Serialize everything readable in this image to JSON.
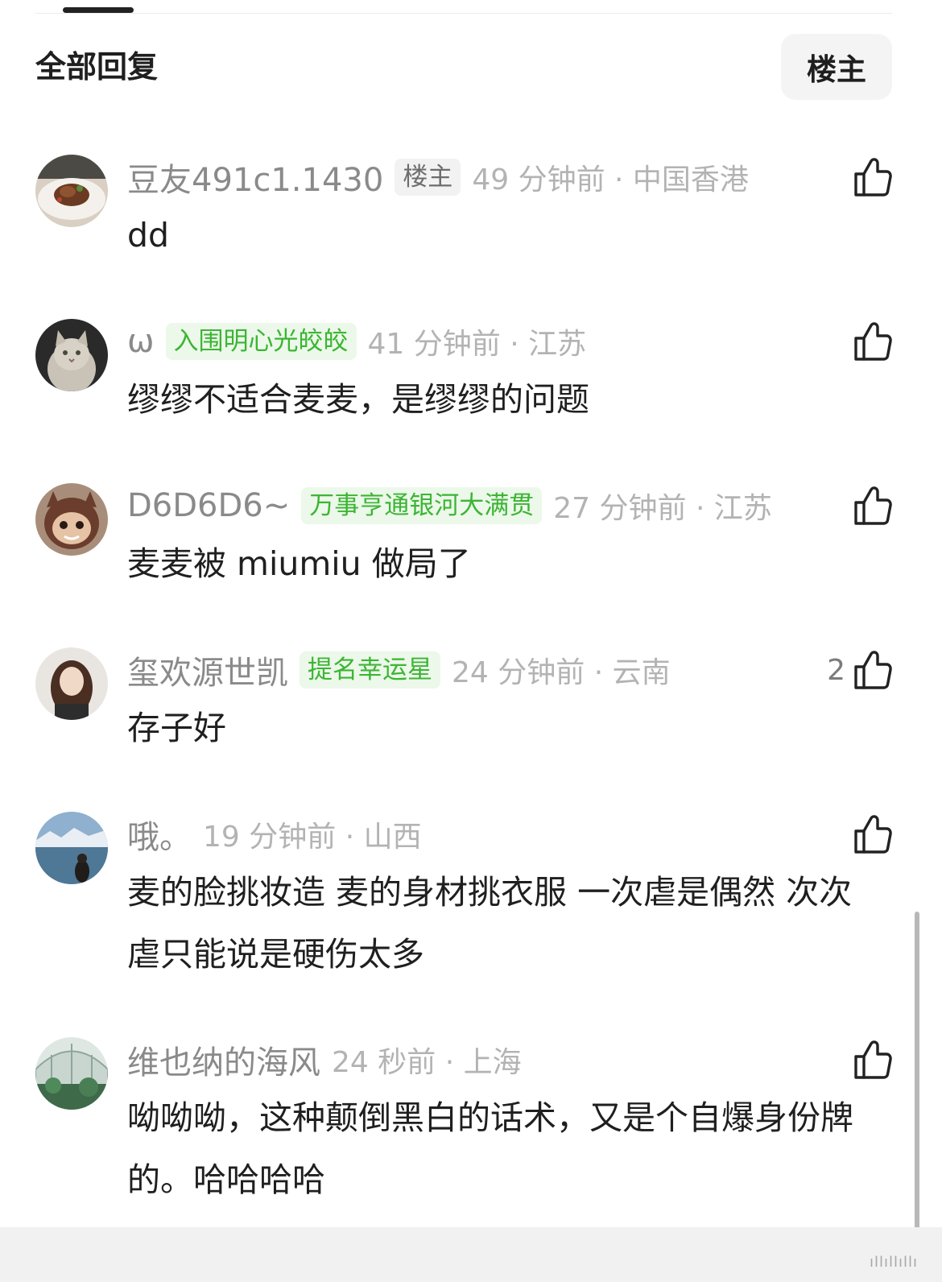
{
  "header": {
    "title": "全部回复",
    "op_filter_label": "楼主"
  },
  "comments": [
    {
      "username": "豆友491c1.1430",
      "badge": "楼主",
      "time_location": "49 分钟前 · 中国香港",
      "text": "dd",
      "likes": "",
      "avatar": "food-plate-photo"
    },
    {
      "username": "ω",
      "badge": "入围明心光皎皎",
      "time_location": "41 分钟前 · 江苏",
      "text": "缪缪不适合麦麦，是缪缪的问题",
      "likes": "",
      "avatar": "cat-photo"
    },
    {
      "username": "D6D6D6~",
      "badge": "万事亨通银河大满贯",
      "time_location": "27 分钟前 · 江苏",
      "text": "麦麦被 miumiu 做局了",
      "likes": "",
      "avatar": "toy-figure-photo"
    },
    {
      "username": "玺欢源世凯",
      "badge": "提名幸运星",
      "time_location": "24 分钟前 · 云南",
      "text": "存子好",
      "likes": "2",
      "avatar": "girl-portrait-photo"
    },
    {
      "username": "哦。",
      "badge": "",
      "time_location": "19 分钟前 · 山西",
      "text": "麦的脸挑妆造  麦的身材挑衣服  一次虐是偶然  次次虐只能说是硬伤太多",
      "likes": "",
      "avatar": "lake-mountain-photo"
    },
    {
      "username": "维也纳的海风",
      "badge": "",
      "time_location": "24 秒前 · 上海",
      "text": "呦呦呦，这种颠倒黑白的话术，又是个自爆身份牌的。哈哈哈哈",
      "likes": "",
      "avatar": "greenhouse-photo"
    }
  ],
  "icons": {
    "like": "thumbs-up-icon"
  },
  "colors": {
    "badge_green_text": "#3cb534",
    "badge_green_bg": "#ecf8ea",
    "meta_gray": "#b3b3b3",
    "username_gray": "#8a8a8a"
  }
}
